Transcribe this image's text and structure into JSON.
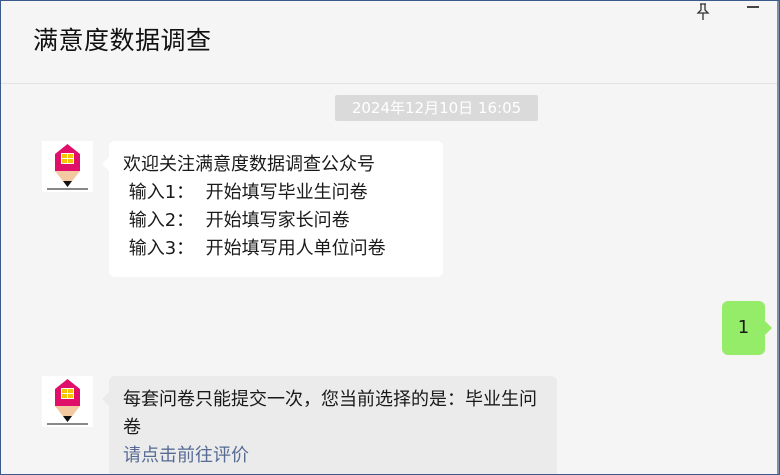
{
  "window": {
    "title": "满意度数据调查"
  },
  "controls": {
    "pin_icon": "pin-icon",
    "minimize_icon": "minimize-icon"
  },
  "messages": {
    "timestamp": "2024年12月10日 16:05",
    "welcome": {
      "lines": [
        "欢迎关注满意度数据调查公众号",
        " 输入1：  开始填写毕业生问卷",
        " 输入2：  开始填写家长问卷",
        " 输入3：  开始填写用人单位问卷"
      ]
    },
    "user_reply": "1",
    "response": {
      "text": "每套问卷只能提交一次，您当前选择的是：毕业生问卷",
      "link": "请点击前往评价"
    }
  },
  "colors": {
    "background": "#f5f5f5",
    "bubble_in": "#ffffff",
    "bubble_out": "#95ec69",
    "link": "#576b95",
    "timestamp_bg": "#dadada"
  }
}
